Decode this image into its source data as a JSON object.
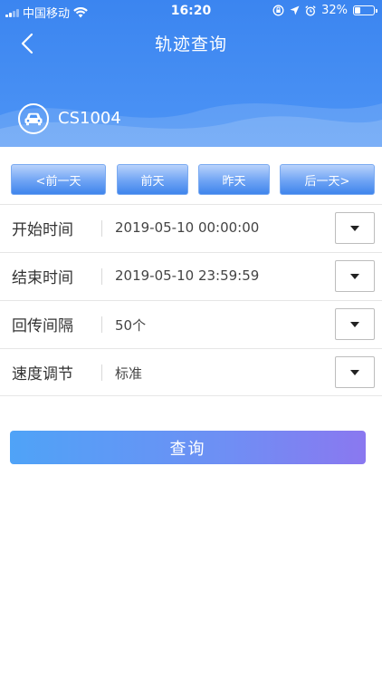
{
  "status_bar": {
    "carrier": "中国移动",
    "time": "16:20",
    "battery_percent": "32%",
    "battery_level": 0.32,
    "icons": [
      "signal-icon",
      "wifi-icon",
      "rotation-lock-icon",
      "location-arrow-icon",
      "alarm-icon",
      "battery-icon"
    ]
  },
  "header": {
    "title": "轨迹查询",
    "back_icon": "chevron-left-icon",
    "vehicle_icon": "car-icon",
    "plate": "CS1004"
  },
  "day_buttons": [
    "<前一天",
    "前天",
    "昨天",
    "后一天>"
  ],
  "form": {
    "rows": [
      {
        "label": "开始时间",
        "value": "2019-05-10 00:00:00"
      },
      {
        "label": "结束时间",
        "value": "2019-05-10 23:59:59"
      },
      {
        "label": "回传间隔",
        "value": "50个"
      },
      {
        "label": "速度调节",
        "value": "标准"
      }
    ],
    "dropdown_icon": "caret-down-icon"
  },
  "query_button": "查询",
  "colors": {
    "header_blue": "#3b85f0",
    "button_blue": "#6ea3f4",
    "query_start": "#4fa3f7",
    "query_end": "#8a78f0"
  }
}
